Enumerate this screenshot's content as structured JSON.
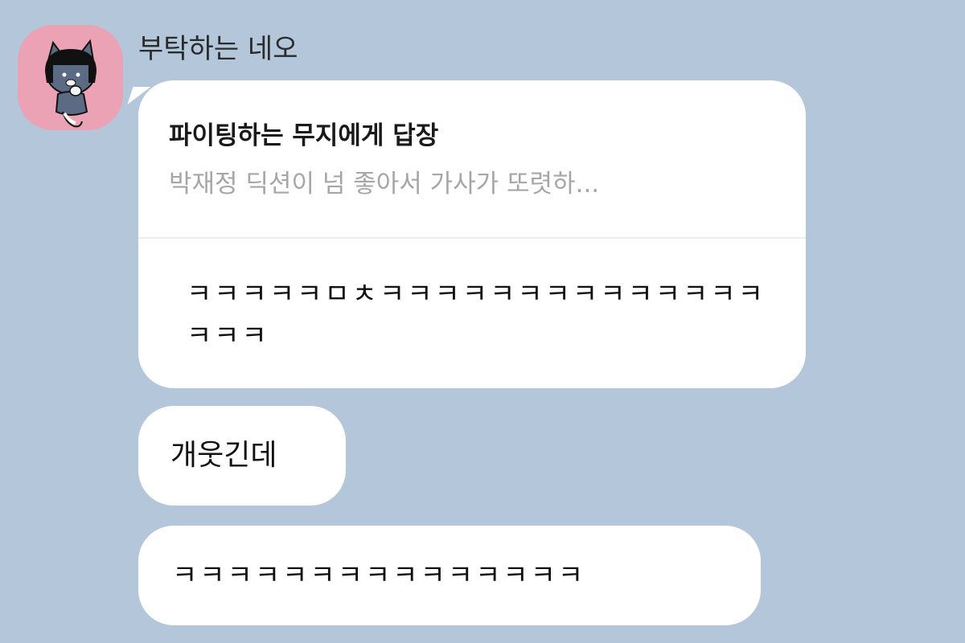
{
  "sender": {
    "name": "부탁하는 네오",
    "avatar_icon": "neo-character-avatar-icon"
  },
  "messages": [
    {
      "reply_to": {
        "title": "파이팅하는 무지에게 답장",
        "preview": "박재정 딕션이 넘 좋아서 가사가 또렷하..."
      },
      "text": "ㅋㅋㅋㅋㅋㅁㅊㅋㅋㅋㅋㅋㅋㅋㅋㅋㅋㅋㅋㅋㅋㅋㅋㅋ"
    },
    {
      "text": "개웃긴데"
    },
    {
      "text": "ㅋㅋㅋㅋㅋㅋㅋㅋㅋㅋㅋㅋㅋㅋㅋ"
    }
  ],
  "colors": {
    "background": "#b3c6da",
    "bubble": "#ffffff",
    "avatar_bg": "#eaa2b4",
    "preview_text": "#a6a6a6"
  }
}
